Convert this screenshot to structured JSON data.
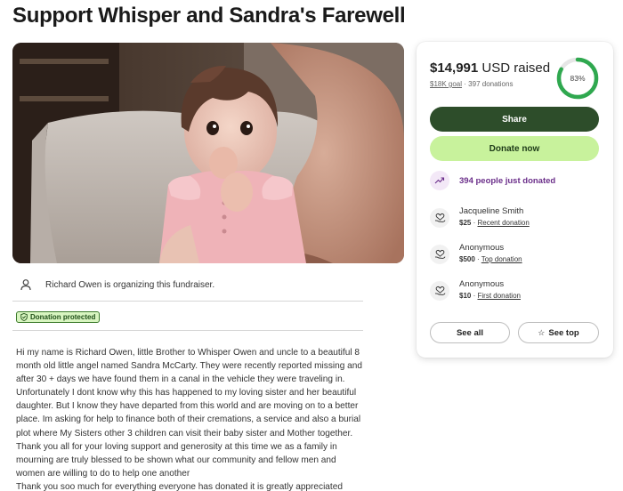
{
  "campaign": {
    "title": "Support Whisper and Sandra's Farewell"
  },
  "organizer": {
    "icon": "user-icon",
    "text": "Richard Owen is organizing this fundraiser."
  },
  "badge": {
    "icon": "shield-check-icon",
    "label": "Donation protected"
  },
  "story": {
    "lines": [
      "Hi my name is Richard Owen, little Brother to Whisper Owen and uncle to a beautiful 8",
      "month old little angel named Sandra McCarty. They were recently reported missing and",
      "after 30 + days we have found them in a canal in the vehicle they were traveling in.",
      "Unfortunately I dont know why this has happened to my loving sister and her beautiful",
      "daughter. But I know they have departed from this world and are moving on to a better",
      "place. Im asking for help to finance both of their cremations, a service and also a burial",
      "plot where My Sisters other 3 children can visit their baby sister and Mother together.",
      "Thank you all for your loving support and generosity at this time we as a family in",
      "mourning are truly blessed to be shown what our community and fellow men and",
      "women are willing to do to help one another",
      "Thank you soo much for everything everyone has donated it is greatly appreciated"
    ]
  },
  "progress": {
    "raised": "$14,991",
    "raised_suffix": "USD raised",
    "goal": "$18K goal",
    "separator": "·",
    "donations": "397 donations",
    "percent_label": "83%",
    "percent_value": 0.83,
    "ring_color": "#2fa84f",
    "ring_track_color": "#e6e6e6"
  },
  "actions": {
    "share_label": "Share",
    "donate_label": "Donate now",
    "share_color": "#2d4d2a",
    "donate_color": "#c8f29c"
  },
  "trending": {
    "icon": "trending-up-icon",
    "text": "394 people just donated",
    "color": "#6b2f8a"
  },
  "donors": [
    {
      "name": "Jacqueline Smith",
      "amount": "$25",
      "sep": "·",
      "tag": "Recent donation",
      "icon": "heart-hand-icon"
    },
    {
      "name": "Anonymous",
      "amount": "$500",
      "sep": "·",
      "tag": "Top donation",
      "icon": "heart-hand-icon"
    },
    {
      "name": "Anonymous",
      "amount": "$10",
      "sep": "·",
      "tag": "First donation",
      "icon": "heart-hand-icon"
    }
  ],
  "footer_buttons": {
    "see_all": "See all",
    "see_top": "See top",
    "star_icon": "star-icon"
  }
}
